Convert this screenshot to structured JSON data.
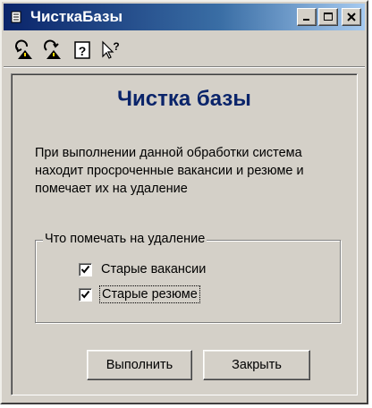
{
  "window": {
    "title": "ЧисткаБазы",
    "icons": {
      "app": "paper-icon",
      "minimize": "minimize-icon",
      "maximize": "maximize-icon",
      "close": "close-icon"
    }
  },
  "toolbar": {
    "tools": [
      {
        "name": "transfer-in-icon"
      },
      {
        "name": "transfer-out-icon"
      },
      {
        "name": "help-icon"
      },
      {
        "name": "context-help-icon"
      }
    ]
  },
  "main": {
    "heading": "Чистка базы",
    "description_lines": [
      "При выполнении данной обработки система",
      "находит просроченные вакансии и резюме и",
      "помечает их на удаление"
    ]
  },
  "group": {
    "legend": "Что помечать на удаление",
    "options": [
      {
        "label": "Старые вакансии",
        "checked": true
      },
      {
        "label": "Старые резюме",
        "checked": true
      }
    ]
  },
  "buttons": {
    "run": "Выполнить",
    "close": "Закрыть"
  },
  "colors": {
    "title_bar_start": "#0a246a",
    "title_bar_end": "#a6caf0",
    "heading": "#0a246a",
    "face": "#d4d0c8"
  }
}
